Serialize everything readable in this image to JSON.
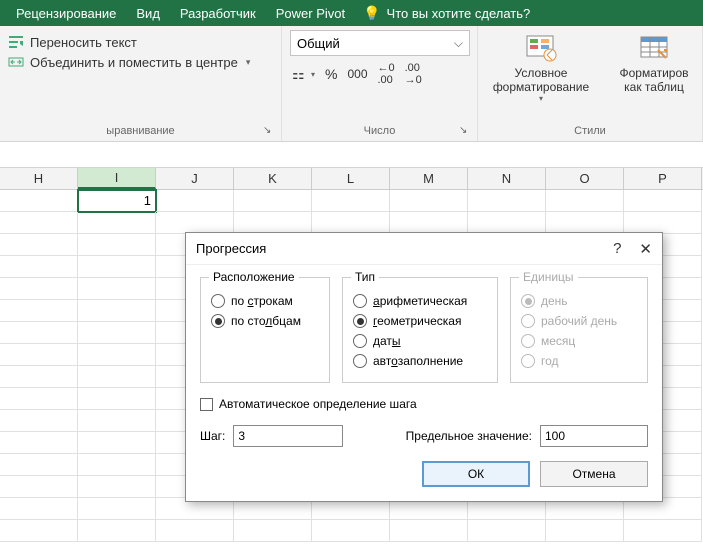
{
  "menubar": {
    "tabs": [
      "Рецензирование",
      "Вид",
      "Разработчик",
      "Power Pivot"
    ],
    "tell_me": "Что вы хотите сделать?"
  },
  "ribbon": {
    "alignment": {
      "wrap": "Переносить текст",
      "merge": "Объединить и поместить в центре",
      "label": "ыравнивание"
    },
    "number": {
      "format": "Общий",
      "label": "Число"
    },
    "styles": {
      "cond": "Условное форматирование",
      "table": "Форматиров как таблиц",
      "label": "Стили"
    }
  },
  "sheet": {
    "columns": [
      "H",
      "I",
      "J",
      "K",
      "L",
      "M",
      "N",
      "O",
      "P"
    ],
    "selected_col_index": 1,
    "selected_value": "1"
  },
  "dialog": {
    "title": "Прогрессия",
    "help": "?",
    "close": "✕",
    "layout": {
      "legend": "Расположение",
      "rows": "по строкам",
      "cols": "по столбцам"
    },
    "type": {
      "legend": "Тип",
      "arith": "арифметическая",
      "geom": "геометрическая",
      "dates": "даты",
      "autofill": "автозаполнение"
    },
    "units": {
      "legend": "Единицы",
      "day": "день",
      "weekday": "рабочий день",
      "month": "месяц",
      "year": "год"
    },
    "auto_step": "Автоматическое определение шага",
    "step_label": "Шаг:",
    "step_value": "3",
    "limit_label": "Предельное значение:",
    "limit_value": "100",
    "ok": "ОК",
    "cancel": "Отмена"
  }
}
